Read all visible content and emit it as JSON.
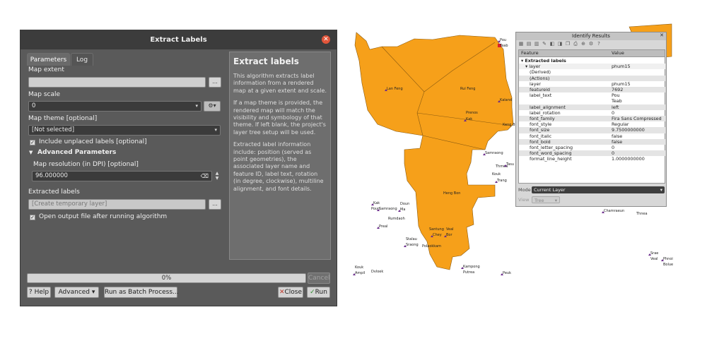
{
  "dialog": {
    "title": "Extract Labels",
    "close_glyph": "✕",
    "tabs": [
      "Parameters",
      "Log"
    ],
    "map_extent": {
      "label": "Map extent",
      "value": "",
      "button": "..."
    },
    "map_scale": {
      "label": "Map scale",
      "value": "0"
    },
    "map_theme": {
      "label": "Map theme [optional]",
      "value": "[Not selected]"
    },
    "include_unplaced": {
      "label": "Include unplaced labels [optional]",
      "checked": true
    },
    "advanced": {
      "label": "Advanced Parameters"
    },
    "map_resolution": {
      "label": "Map resolution (in DPI) [optional]",
      "value": "96.000000"
    },
    "extracted_labels": {
      "label": "Extracted labels",
      "placeholder": "[Create temporary layer]",
      "button": "..."
    },
    "open_output": {
      "label": "Open output file after running algorithm",
      "checked": true
    },
    "help": {
      "title": "Extract labels",
      "paragraphs": [
        "This algorithm extracts label information from a rendered map at a given extent and scale.",
        "If a map theme is provided, the rendered map will match the visibility and symbology of that theme. If left blank, the project's layer tree setup will be used.",
        "Extracted label information include: position (served as point geometries), the associated layer name and feature ID, label text, rotation (in degree, clockwise), multiline alignment, and font details."
      ]
    },
    "progress": "0%",
    "buttons": {
      "cancel": "Cancel",
      "help": "Help",
      "advanced": "Advanced",
      "batch": "Run as Batch Process...",
      "close": "Close",
      "run": "Run"
    }
  },
  "identify": {
    "title": "Identify Results",
    "columns": [
      "Feature",
      "Value"
    ],
    "rows": [
      {
        "field": "Extracted labels",
        "value": "",
        "indent": 0,
        "bold": true
      },
      {
        "field": "layer",
        "value": "phum15",
        "indent": 1
      },
      {
        "field": "(Derived)",
        "value": "",
        "indent": 2
      },
      {
        "field": "(Actions)",
        "value": "",
        "indent": 2
      },
      {
        "field": "layer",
        "value": "phum15",
        "indent": 2
      },
      {
        "field": "featureid",
        "value": "7692",
        "indent": 2
      },
      {
        "field": "label_text",
        "value": "Pou\nTeab",
        "indent": 2
      },
      {
        "field": "label_alignment",
        "value": "left",
        "indent": 2
      },
      {
        "field": "label_rotation",
        "value": "0",
        "indent": 2
      },
      {
        "field": "font_family",
        "value": "Fira Sans Compressed",
        "indent": 2
      },
      {
        "field": "font_style",
        "value": "Regular",
        "indent": 2
      },
      {
        "field": "font_size",
        "value": "9.7500000000",
        "indent": 2
      },
      {
        "field": "font_italic",
        "value": "false",
        "indent": 2
      },
      {
        "field": "font_bold",
        "value": "false",
        "indent": 2
      },
      {
        "field": "font_letter_spacing",
        "value": "0",
        "indent": 2
      },
      {
        "field": "font_word_spacing",
        "value": "0",
        "indent": 2
      },
      {
        "field": "format_line_height",
        "value": "1.0000000000",
        "indent": 2
      }
    ],
    "mode_label": "Mode",
    "mode_value": "Current Layer",
    "view_label": "View",
    "view_value": "Tree"
  },
  "map": {
    "fill_color": "#f6a01a",
    "labels": [
      "Pou",
      "Teab",
      "Lan Feng",
      "Rui Feng",
      "Kaland",
      "Prenos",
      "Kak",
      "Keng Bun",
      "Samraong",
      "Thmea",
      "Tasu",
      "Kouk",
      "Trang",
      "Heng Bon",
      "Kak",
      "Poun",
      "Samraong",
      "Doun",
      "Ma",
      "Rumdaoh",
      "Preal",
      "Santung",
      "Chey",
      "Veal",
      "Bor",
      "Stalau",
      "Sraong",
      "Polaokkam",
      "Kampong",
      "Putrea",
      "Peuk",
      "Kouk",
      "Ampil",
      "Dvloek",
      "Chamraeun",
      "Thnea",
      "Srae",
      "Veal",
      "Phnoi",
      "Bolue"
    ]
  },
  "colors": {
    "accent_close": "#e2553a",
    "map_fill": "#f6a01a"
  }
}
